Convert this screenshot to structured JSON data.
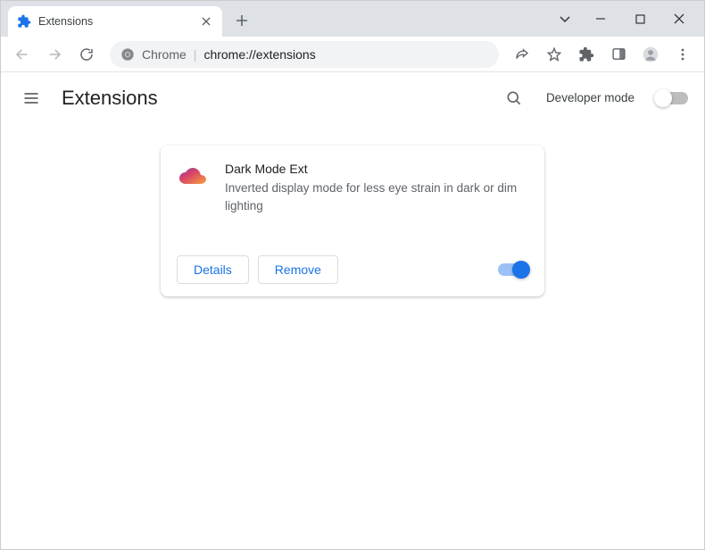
{
  "browser": {
    "tab_title": "Extensions",
    "omnibox_prefix": "Chrome",
    "omnibox_url": "chrome://extensions"
  },
  "page": {
    "title": "Extensions",
    "developer_mode_label": "Developer mode"
  },
  "extension": {
    "name": "Dark Mode Ext",
    "description": "Inverted display mode for less eye strain in dark or dim lighting",
    "details_label": "Details",
    "remove_label": "Remove",
    "enabled": true
  }
}
